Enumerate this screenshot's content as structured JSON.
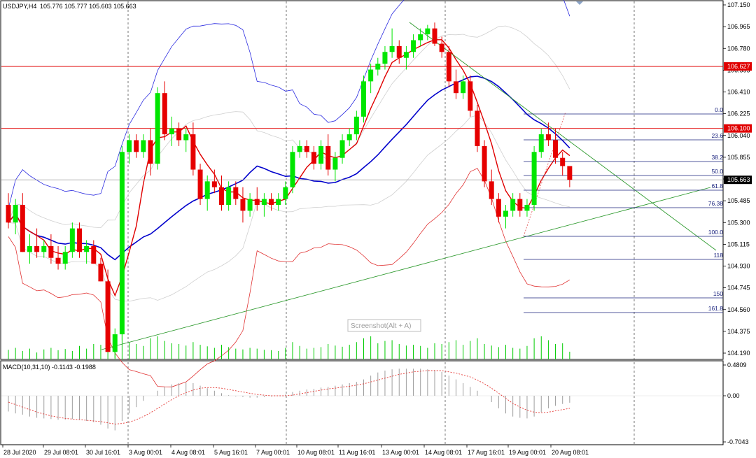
{
  "header": {
    "symbol": "USDJPY,H4",
    "ohlc": "105.776 105.777 105.603 105.663"
  },
  "macd": {
    "label": "MACD(10,31,10) -0.1143 -0.1988"
  },
  "watermark": "Screenshot(Alt + A)",
  "colors": {
    "bull": "#00e600",
    "bear": "#e60000",
    "ma_fast": "#e00000",
    "ma_slow": "#0000cc",
    "bb_upper": "#2a2ae0",
    "bb_lower": "#e03030",
    "tag_bg": "#e00000",
    "tag_price": "#000000"
  },
  "price_axis": {
    "ticks": [
      "107.150",
      "106.965",
      "106.780",
      "106.595",
      "106.410",
      "106.225",
      "106.040",
      "105.855",
      "105.670",
      "105.485",
      "105.300",
      "105.115",
      "104.930",
      "104.745",
      "104.560",
      "104.375",
      "104.190"
    ],
    "hlines": [
      {
        "text": "106.627",
        "value": 106.627
      },
      {
        "text": "106.100",
        "value": 106.1
      }
    ],
    "current": {
      "text": "105.663",
      "value": 105.663
    }
  },
  "macd_axis": {
    "ticks": [
      "0.4809",
      "0.00",
      "-0.7043"
    ]
  },
  "time_axis": {
    "labels": [
      "28 Jul 2020",
      "29 Jul 08:01",
      "30 Jul 16:01",
      "3 Aug 00:01",
      "4 Aug 08:01",
      "5 Aug 16:01",
      "7 Aug 00:01",
      "10 Aug 08:01",
      "11 Aug 16:01",
      "13 Aug 00:01",
      "14 Aug 08:01",
      "17 Aug 16:01",
      "19 Aug 00:01",
      "20 Aug 08:01"
    ]
  },
  "fibonacci": {
    "levels": [
      "0.0",
      "23.6",
      "38.2",
      "50.0",
      "61.8",
      "76.38",
      "100.0",
      "118",
      "150",
      "161.8"
    ]
  },
  "chart_data": {
    "type": "candlestick",
    "symbol": "USDJPY",
    "timeframe": "H4",
    "ylim": [
      104.13,
      107.17
    ],
    "candles": [
      [
        105.45,
        105.55,
        105.25,
        105.3
      ],
      [
        105.3,
        105.5,
        105.2,
        105.45
      ],
      [
        105.45,
        105.55,
        105.05,
        105.05
      ],
      [
        105.05,
        105.2,
        104.95,
        105.1
      ],
      [
        105.1,
        105.25,
        105.0,
        105.05
      ],
      [
        105.05,
        105.15,
        105.0,
        105.1
      ],
      [
        105.1,
        105.2,
        104.95,
        105.0
      ],
      [
        105.0,
        105.1,
        104.9,
        104.95
      ],
      [
        104.95,
        105.1,
        104.9,
        105.05
      ],
      [
        105.05,
        105.3,
        105.0,
        105.25
      ],
      [
        105.25,
        105.3,
        105.0,
        105.05
      ],
      [
        105.05,
        105.15,
        104.95,
        105.1
      ],
      [
        105.1,
        105.15,
        104.95,
        104.95
      ],
      [
        104.95,
        105.0,
        104.8,
        104.8
      ],
      [
        104.8,
        104.9,
        104.2,
        104.2
      ],
      [
        104.2,
        104.4,
        104.15,
        104.35
      ],
      [
        104.35,
        105.95,
        104.3,
        105.9
      ],
      [
        105.9,
        106.05,
        105.8,
        106.0
      ],
      [
        106.0,
        106.05,
        105.85,
        105.9
      ],
      [
        105.9,
        106.05,
        105.85,
        106.0
      ],
      [
        106.0,
        106.1,
        105.7,
        105.8
      ],
      [
        105.8,
        106.45,
        105.75,
        106.4
      ],
      [
        106.4,
        106.5,
        106.0,
        106.05
      ],
      [
        106.05,
        106.2,
        105.95,
        106.1
      ],
      [
        106.1,
        106.15,
        105.95,
        106.0
      ],
      [
        106.0,
        106.1,
        105.9,
        106.05
      ],
      [
        106.05,
        106.15,
        105.7,
        105.75
      ],
      [
        105.75,
        105.8,
        105.45,
        105.5
      ],
      [
        105.5,
        105.7,
        105.4,
        105.65
      ],
      [
        105.65,
        105.75,
        105.55,
        105.6
      ],
      [
        105.6,
        105.7,
        105.4,
        105.45
      ],
      [
        105.45,
        105.65,
        105.4,
        105.6
      ],
      [
        105.6,
        105.65,
        105.45,
        105.5
      ],
      [
        105.5,
        105.6,
        105.3,
        105.4
      ],
      [
        105.4,
        105.55,
        105.35,
        105.5
      ],
      [
        105.5,
        105.6,
        105.4,
        105.45
      ],
      [
        105.45,
        105.55,
        105.35,
        105.5
      ],
      [
        105.5,
        105.55,
        105.4,
        105.45
      ],
      [
        105.45,
        105.55,
        105.4,
        105.5
      ],
      [
        105.5,
        105.65,
        105.45,
        105.6
      ],
      [
        105.6,
        105.95,
        105.55,
        105.9
      ],
      [
        105.9,
        106.0,
        105.85,
        105.95
      ],
      [
        105.95,
        106.0,
        105.85,
        105.9
      ],
      [
        105.9,
        105.95,
        105.75,
        105.8
      ],
      [
        105.8,
        106.0,
        105.75,
        105.95
      ],
      [
        105.95,
        106.05,
        105.7,
        105.75
      ],
      [
        105.75,
        105.9,
        105.65,
        105.85
      ],
      [
        105.85,
        106.05,
        105.8,
        106.0
      ],
      [
        106.0,
        106.1,
        105.95,
        106.05
      ],
      [
        106.05,
        106.25,
        106.0,
        106.2
      ],
      [
        106.2,
        106.55,
        106.15,
        106.5
      ],
      [
        106.5,
        106.65,
        106.4,
        106.6
      ],
      [
        106.6,
        106.7,
        106.55,
        106.65
      ],
      [
        106.65,
        106.8,
        106.6,
        106.75
      ],
      [
        106.75,
        106.95,
        106.7,
        106.8
      ],
      [
        106.8,
        106.85,
        106.65,
        106.7
      ],
      [
        106.7,
        106.8,
        106.6,
        106.75
      ],
      [
        106.75,
        106.9,
        106.7,
        106.85
      ],
      [
        106.85,
        106.95,
        106.8,
        106.9
      ],
      [
        106.9,
        106.98,
        106.85,
        106.95
      ],
      [
        106.95,
        107.0,
        106.8,
        106.82
      ],
      [
        106.82,
        106.88,
        106.7,
        106.75
      ],
      [
        106.75,
        106.8,
        106.45,
        106.5
      ],
      [
        106.5,
        106.6,
        106.35,
        106.4
      ],
      [
        106.4,
        106.55,
        106.35,
        106.5
      ],
      [
        106.5,
        106.55,
        106.2,
        106.25
      ],
      [
        106.25,
        106.3,
        105.9,
        105.95
      ],
      [
        105.95,
        106.0,
        105.6,
        105.65
      ],
      [
        105.65,
        105.75,
        105.45,
        105.5
      ],
      [
        105.5,
        105.55,
        105.3,
        105.35
      ],
      [
        105.35,
        105.45,
        105.25,
        105.4
      ],
      [
        105.4,
        105.55,
        105.35,
        105.5
      ],
      [
        105.5,
        105.55,
        105.35,
        105.4
      ],
      [
        105.4,
        105.5,
        105.35,
        105.45
      ],
      [
        105.45,
        105.95,
        105.4,
        105.9
      ],
      [
        105.9,
        106.1,
        105.85,
        106.05
      ],
      [
        106.05,
        106.15,
        105.95,
        106.0
      ],
      [
        106.0,
        106.1,
        105.8,
        105.85
      ],
      [
        105.85,
        105.9,
        105.7,
        105.78
      ],
      [
        105.78,
        105.78,
        105.6,
        105.663
      ]
    ],
    "volume": [
      25,
      30,
      22,
      28,
      18,
      26,
      30,
      24,
      27,
      22,
      35,
      28,
      40,
      38,
      50,
      60,
      75,
      45,
      40,
      35,
      55,
      60,
      48,
      42,
      40,
      36,
      45,
      38,
      34,
      30,
      38,
      32,
      28,
      26,
      30,
      28,
      25,
      24,
      22,
      30,
      45,
      35,
      28,
      30,
      32,
      40,
      36,
      33,
      38,
      45,
      55,
      60,
      42,
      48,
      50,
      40,
      36,
      38,
      35,
      30,
      42,
      40,
      45,
      50,
      38,
      48,
      55,
      40,
      36,
      32,
      38,
      30,
      28,
      35,
      55,
      60,
      50,
      40,
      42,
      20
    ],
    "macd_hist": [
      -0.25,
      -0.28,
      -0.3,
      -0.33,
      -0.35,
      -0.36,
      -0.37,
      -0.38,
      -0.38,
      -0.37,
      -0.38,
      -0.4,
      -0.42,
      -0.46,
      -0.52,
      -0.55,
      -0.4,
      -0.28,
      -0.18,
      -0.08,
      0.0,
      0.08,
      0.14,
      0.18,
      0.2,
      0.21,
      0.2,
      0.16,
      0.12,
      0.08,
      0.04,
      0.01,
      -0.01,
      -0.02,
      -0.03,
      -0.03,
      -0.02,
      -0.01,
      0.0,
      0.02,
      0.06,
      0.08,
      0.1,
      0.11,
      0.13,
      0.14,
      0.16,
      0.18,
      0.2,
      0.22,
      0.26,
      0.32,
      0.37,
      0.4,
      0.42,
      0.43,
      0.43,
      0.43,
      0.43,
      0.42,
      0.41,
      0.38,
      0.32,
      0.26,
      0.2,
      0.14,
      0.08,
      0.0,
      -0.1,
      -0.2,
      -0.28,
      -0.33,
      -0.35,
      -0.36,
      -0.33,
      -0.26,
      -0.2,
      -0.16,
      -0.13,
      -0.11
    ],
    "macd_signal": [
      -0.1,
      -0.14,
      -0.18,
      -0.22,
      -0.26,
      -0.29,
      -0.32,
      -0.34,
      -0.36,
      -0.37,
      -0.38,
      -0.39,
      -0.4,
      -0.41,
      -0.43,
      -0.45,
      -0.44,
      -0.42,
      -0.38,
      -0.33,
      -0.27,
      -0.2,
      -0.13,
      -0.06,
      0.0,
      0.05,
      0.09,
      0.12,
      0.13,
      0.13,
      0.12,
      0.1,
      0.08,
      0.06,
      0.04,
      0.02,
      0.01,
      0.0,
      0.0,
      0.0,
      0.01,
      0.03,
      0.05,
      0.07,
      0.09,
      0.11,
      0.12,
      0.14,
      0.15,
      0.17,
      0.19,
      0.22,
      0.25,
      0.28,
      0.31,
      0.34,
      0.36,
      0.38,
      0.39,
      0.4,
      0.4,
      0.4,
      0.38,
      0.36,
      0.33,
      0.3,
      0.25,
      0.19,
      0.12,
      0.04,
      -0.04,
      -0.12,
      -0.18,
      -0.23,
      -0.26,
      -0.27,
      -0.26,
      -0.24,
      -0.22,
      -0.2
    ]
  }
}
